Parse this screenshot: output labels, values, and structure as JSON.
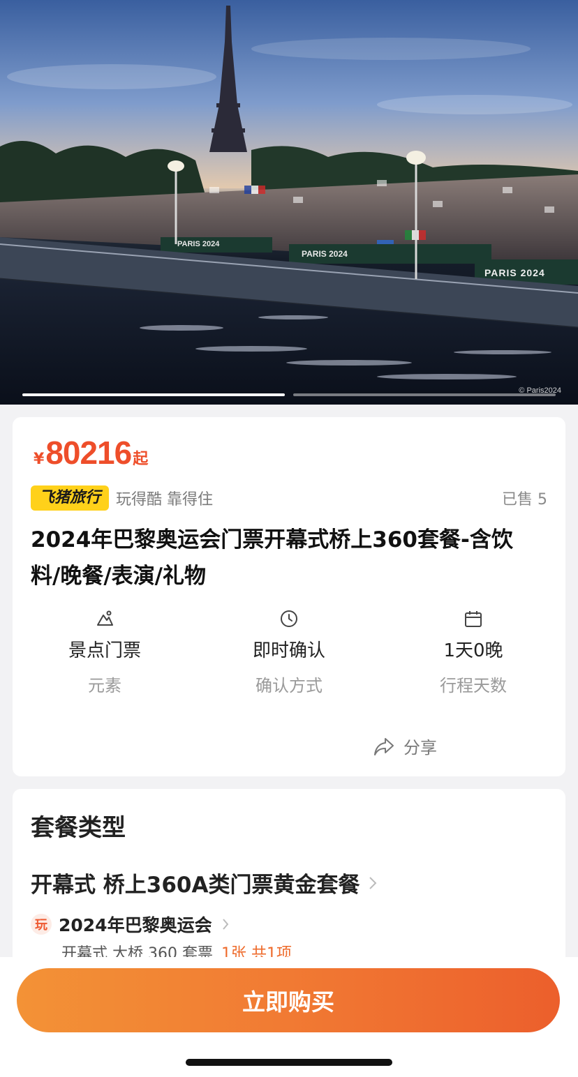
{
  "hero": {
    "copyright": "© Paris2024",
    "banner_texts": [
      "PARIS 2024",
      "PARIS 2024",
      "PARIS 2024"
    ],
    "slide_index": 1,
    "slide_count": 2
  },
  "product": {
    "price_symbol": "¥",
    "price": "80216",
    "price_suffix": "起",
    "brand": "飞猪旅行",
    "brand_slogan": "玩得酷 靠得住",
    "sold": "已售 5",
    "title": "2024年巴黎奥运会门票开幕式桥上360套餐-含饮料/晚餐/表演/礼物"
  },
  "info": [
    {
      "icon": "mountain-icon",
      "value": "景点门票",
      "label": "元素"
    },
    {
      "icon": "clock-icon",
      "value": "即时确认",
      "label": "确认方式"
    },
    {
      "icon": "calendar-icon",
      "value": "1天0晚",
      "label": "行程天数"
    }
  ],
  "share": {
    "label": "分享",
    "icon": "share-icon"
  },
  "package": {
    "section_title": "套餐类型",
    "name": "开幕式 桥上360A类门票黄金套餐",
    "item": {
      "badge": "玩",
      "name": "2024年巴黎奥运会",
      "desc": "开幕式 大桥 360 套票",
      "qty": "1张 共1项"
    }
  },
  "actions": {
    "buy": "立即购买"
  },
  "colors": {
    "accent": "#ee4e2a",
    "brand_yellow": "#ffd11a",
    "button_start": "#f39236",
    "button_end": "#ec5f2c"
  }
}
